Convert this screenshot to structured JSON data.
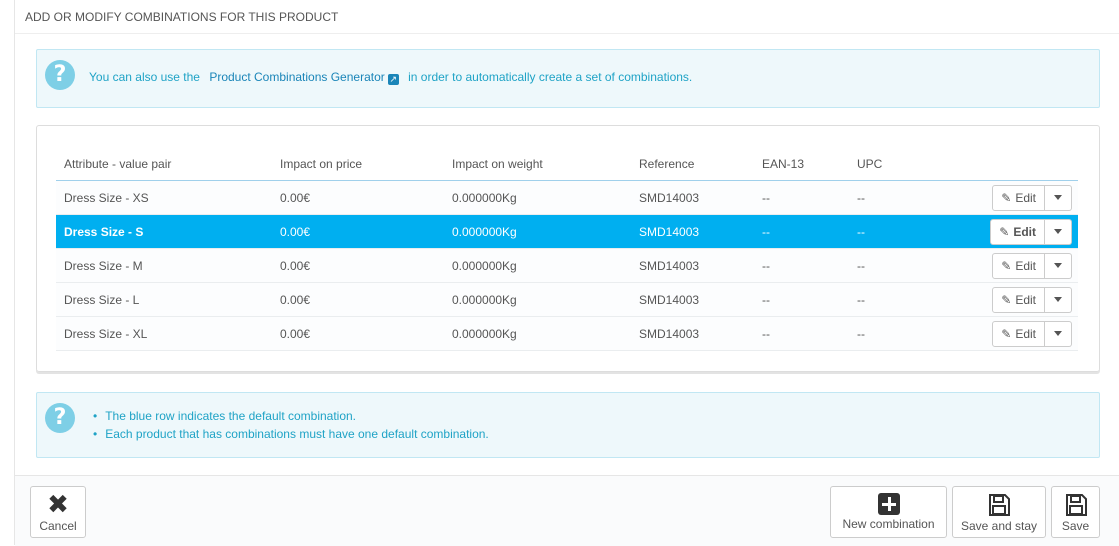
{
  "panel": {
    "title": "ADD OR MODIFY COMBINATIONS FOR THIS PRODUCT"
  },
  "info_alert": {
    "prefix": "You can also use the",
    "link": "Product Combinations Generator",
    "suffix": "in order to automatically create a set of combinations."
  },
  "table": {
    "columns": [
      "Attribute - value pair",
      "Impact on price",
      "Impact on weight",
      "Reference",
      "EAN-13",
      "UPC"
    ],
    "rows": [
      {
        "attr": "Dress Size - XS",
        "price": "0.00€",
        "weight": "0.000000Kg",
        "ref": "SMD14003",
        "ean": "--",
        "upc": "--"
      },
      {
        "attr": "Dress Size - S",
        "price": "0.00€",
        "weight": "0.000000Kg",
        "ref": "SMD14003",
        "ean": "--",
        "upc": "--"
      },
      {
        "attr": "Dress Size - M",
        "price": "0.00€",
        "weight": "0.000000Kg",
        "ref": "SMD14003",
        "ean": "--",
        "upc": "--"
      },
      {
        "attr": "Dress Size - L",
        "price": "0.00€",
        "weight": "0.000000Kg",
        "ref": "SMD14003",
        "ean": "--",
        "upc": "--"
      },
      {
        "attr": "Dress Size - XL",
        "price": "0.00€",
        "weight": "0.000000Kg",
        "ref": "SMD14003",
        "ean": "--",
        "upc": "--"
      }
    ],
    "edit_label": "Edit",
    "default_row_index": 1,
    "default_row_color": "#00aff0"
  },
  "help_alert": {
    "items": [
      "The blue row indicates the default combination.",
      "Each product that has combinations must have one default combination."
    ]
  },
  "footer": {
    "cancel_label": "Cancel",
    "new_combination_label": "New combination",
    "save_and_stay_label": "Save and stay",
    "save_label": "Save"
  },
  "icons": {
    "help": "question-circle-icon",
    "external_link": "external-link-icon",
    "edit": "pencil-icon",
    "dropdown": "caret-down-icon",
    "cancel": "close-icon",
    "new": "plus-square-icon",
    "save": "floppy-disk-icon"
  }
}
